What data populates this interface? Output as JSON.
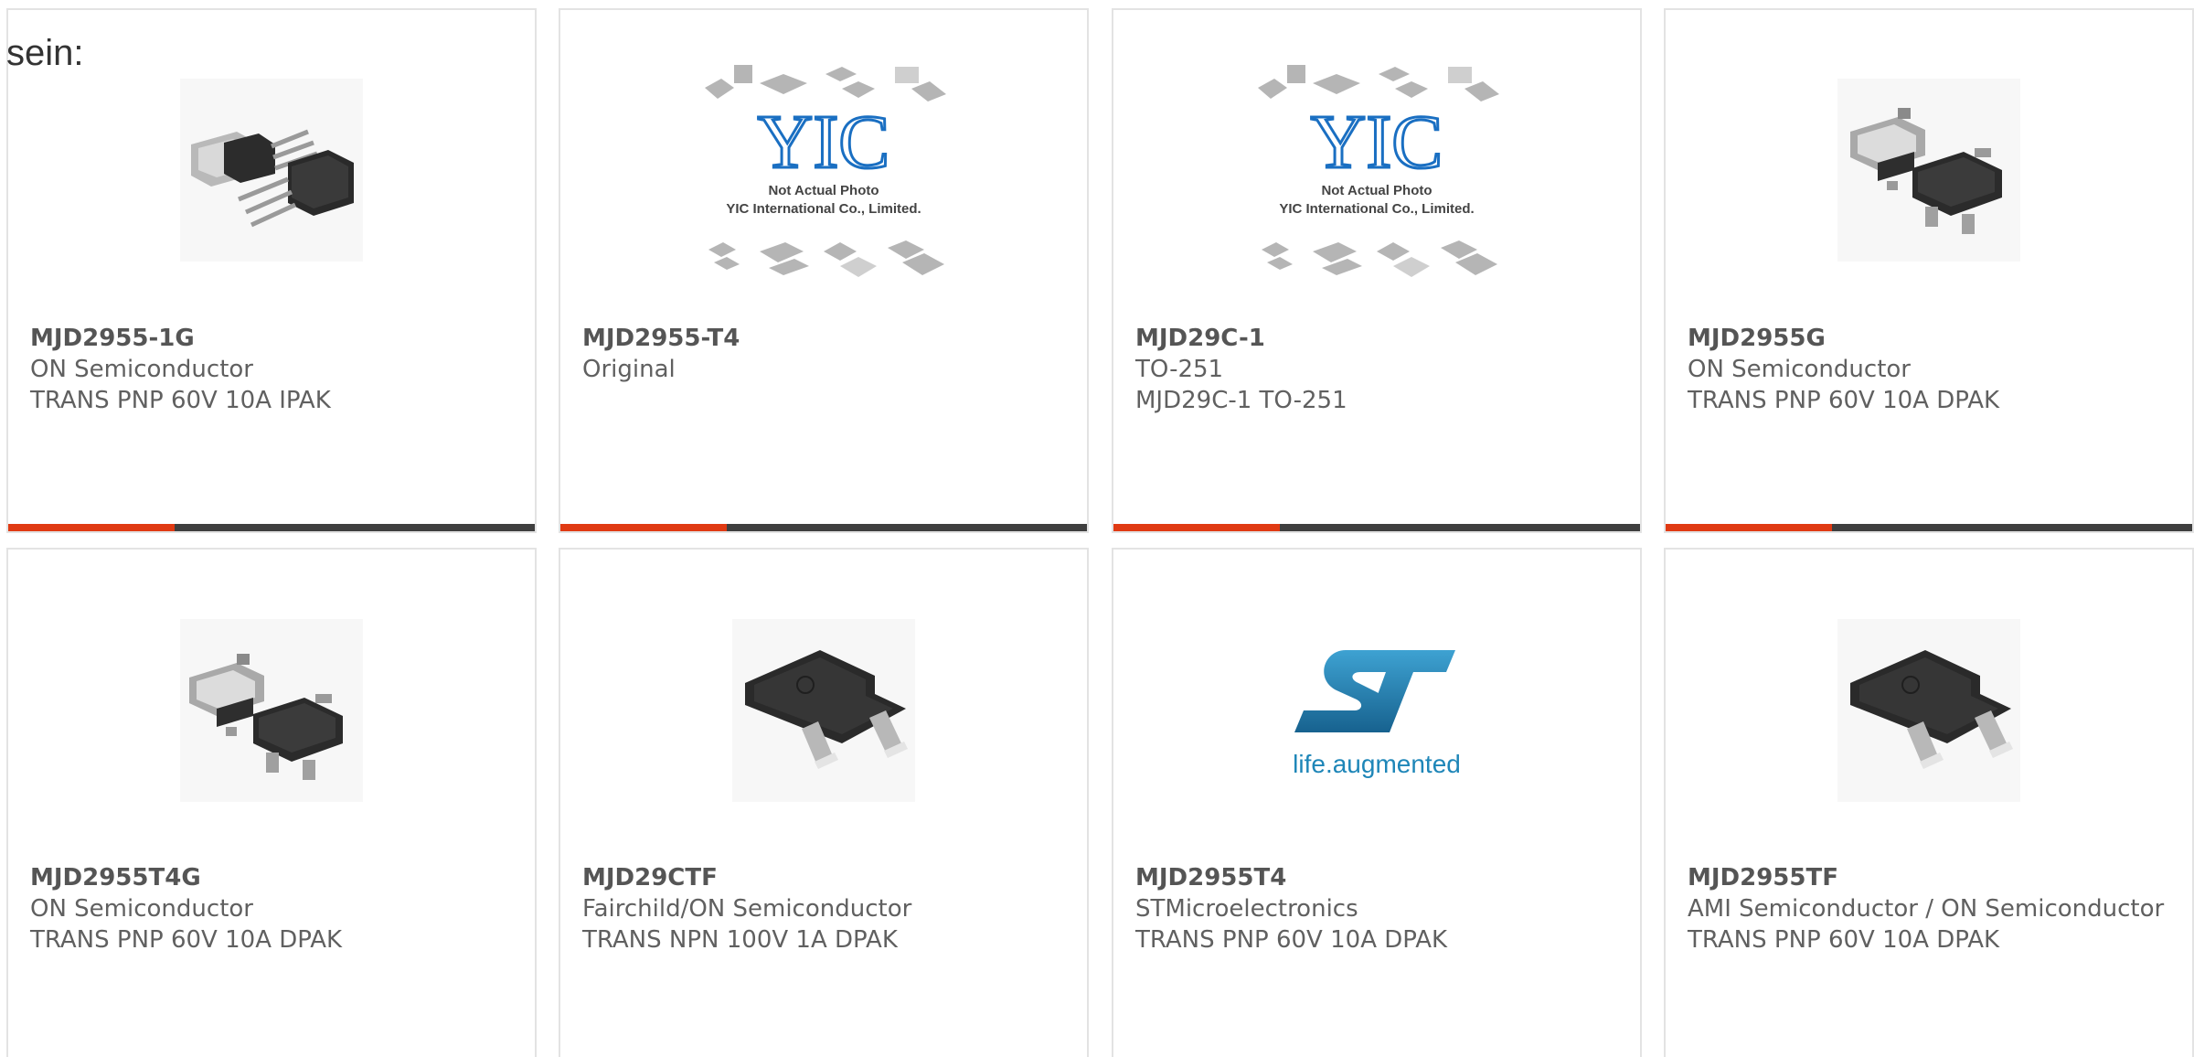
{
  "heading": "sein:",
  "colors": {
    "accent": "#e03a13",
    "bar": "#3f3f3f",
    "border": "#e3e3e3",
    "st_logo_blue": "#1e86b8"
  },
  "products": [
    {
      "part": "MJD2955-1G",
      "line1": "ON Semiconductor",
      "line2": "TRANS PNP 60V 10A IPAK",
      "image": "ipak-transistor-image"
    },
    {
      "part": "MJD2955-T4",
      "line1": "Original",
      "line2": "",
      "image": "yic-placeholder-image",
      "placeholder_line1": "Not Actual Photo",
      "placeholder_line2": "YIC International Co., Limited.",
      "logo_text": "YIC"
    },
    {
      "part": "MJD29C-1",
      "line1": "TO-251",
      "line2": "MJD29C-1 TO-251",
      "image": "yic-placeholder-image",
      "placeholder_line1": "Not Actual Photo",
      "placeholder_line2": "YIC International Co., Limited.",
      "logo_text": "YIC"
    },
    {
      "part": "MJD2955G",
      "line1": "ON Semiconductor",
      "line2": "TRANS PNP 60V 10A DPAK",
      "image": "dpak-transistor-image"
    },
    {
      "part": "MJD2955T4G",
      "line1": "ON Semiconductor",
      "line2": "TRANS PNP 60V 10A DPAK",
      "image": "dpak-transistor-image"
    },
    {
      "part": "MJD29CTF",
      "line1": "Fairchild/ON Semiconductor",
      "line2": "TRANS NPN 100V 1A DPAK",
      "image": "dpak-single-image"
    },
    {
      "part": "MJD2955T4",
      "line1": "STMicroelectronics",
      "line2": "TRANS PNP 60V 10A DPAK",
      "image": "st-logo-image",
      "logo_text": "life.augmented"
    },
    {
      "part": "MJD2955TF",
      "line1": "AMI Semiconductor / ON Semiconductor",
      "line2": "TRANS PNP 60V 10A DPAK",
      "image": "dpak-single-image"
    }
  ]
}
